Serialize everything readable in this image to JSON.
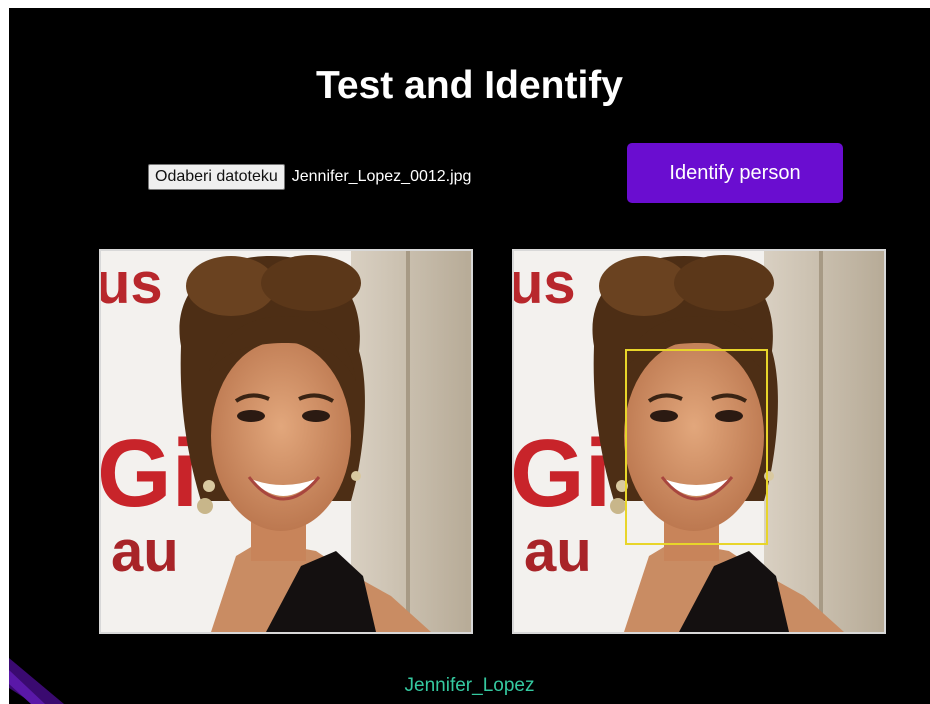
{
  "header": {
    "title": "Test and Identify"
  },
  "upload": {
    "choose_file_label": "Odaberi datoteku",
    "selected_file_name": "Jennifer_Lopez_0012.jpg"
  },
  "actions": {
    "identify_label": "Identify person"
  },
  "result": {
    "identified_name": "Jennifer_Lopez"
  },
  "photo": {
    "sign_letters_top": "us",
    "sign_letters_middle": "Gi",
    "sign_letters_bottom": "au"
  },
  "colors": {
    "background": "#000000",
    "identify_button": "#6a0dd0",
    "result_text": "#35c9a0",
    "face_box": "#e8d52a"
  }
}
